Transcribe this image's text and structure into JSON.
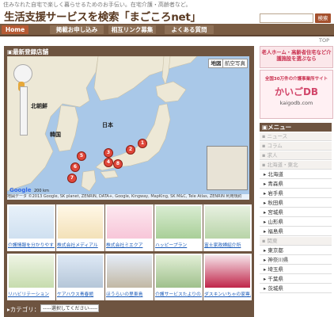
{
  "header": {
    "tagline": "住みなれた自宅で楽しく暮らせるためのお手伝い。在宅介護・高齢者など。",
    "title": "生活支援サービスを検索「まごころnet」",
    "search_button": "検索"
  },
  "nav": {
    "items": [
      "Home",
      "掲載お申し込み",
      "相互リンク募集",
      "よくある質問"
    ],
    "top_link": "TOP"
  },
  "main": {
    "new_header": "▣最新登録店舗",
    "map": {
      "btn_map": "地図",
      "btn_satellite": "航空写真",
      "labels": [
        "北朝鮮",
        "韓国",
        "日本"
      ],
      "pins": [
        "1",
        "2",
        "3",
        "4",
        "5",
        "6",
        "7",
        "8"
      ],
      "scale": "200 km",
      "footer": "地図データ ©2013 Google, SK planet, ZENRIN, DATA+, Google, Kingway, MapKing, SK M&C, Tele Atlas, ZENRIN  利用規約"
    },
    "tiles": [
      {
        "caption": "介護情報を分かりやすく…(小江戸)"
      },
      {
        "caption": "株式会社メディアル"
      },
      {
        "caption": "株式会社ミエクア"
      },
      {
        "caption": "ハッピープラン"
      },
      {
        "caption": "富士家政婦紹介所"
      },
      {
        "caption": "リハビリテーション"
      },
      {
        "caption": "ケアハウス青春館"
      },
      {
        "caption": "ほうらいの里東島"
      },
      {
        "caption": "介護サービスたよりの…"
      },
      {
        "caption": "ダスキンいちゃの家専…"
      }
    ],
    "category_label": "▸カテゴリ：",
    "category_select": "-----選択してください-----"
  },
  "sidebar": {
    "ad1": "老人ホーム・高齢者住宅など介護施設を選ぶなら",
    "ad2_line1": "全国30万件の介護事業所サイト",
    "ad2_brand": "かいごDB",
    "ad2_url": "kaigodb.com",
    "menu_head": "▣メニュー",
    "menu_items": [
      {
        "label": "ニュース",
        "type": "cat"
      },
      {
        "label": "コラム",
        "type": "cat"
      },
      {
        "label": "求人",
        "type": "cat"
      },
      {
        "label": "北海道・東北",
        "type": "cat"
      },
      {
        "label": "北海道",
        "type": "sub"
      },
      {
        "label": "青森県",
        "type": "sub"
      },
      {
        "label": "岩手県",
        "type": "sub"
      },
      {
        "label": "秋田県",
        "type": "sub"
      },
      {
        "label": "宮城県",
        "type": "sub"
      },
      {
        "label": "山形県",
        "type": "sub"
      },
      {
        "label": "福島県",
        "type": "sub"
      },
      {
        "label": "関東",
        "type": "cat"
      },
      {
        "label": "東京都",
        "type": "sub"
      },
      {
        "label": "神奈川県",
        "type": "sub"
      },
      {
        "label": "埼玉県",
        "type": "sub"
      },
      {
        "label": "千葉県",
        "type": "sub"
      },
      {
        "label": "茨城県",
        "type": "sub"
      }
    ]
  },
  "colors": {
    "brown": "#6e5440",
    "accent": "#b65a34",
    "link": "#1a5ab8",
    "pin": "#e0473a"
  }
}
